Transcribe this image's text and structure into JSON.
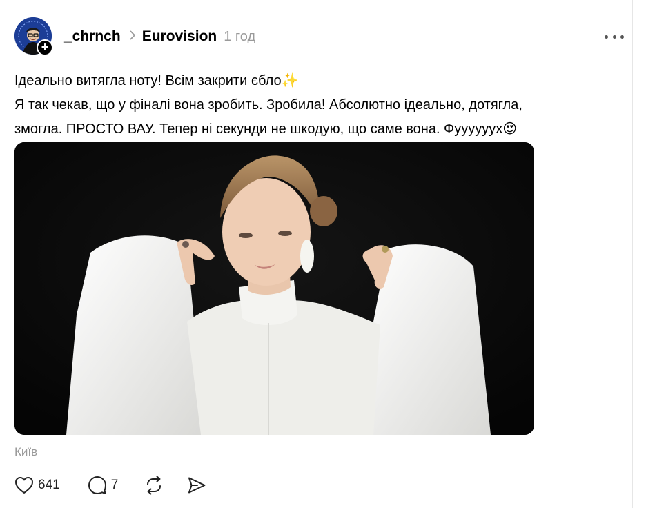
{
  "post": {
    "username": "_chrnch",
    "community": "Eurovision",
    "timestamp": "1 год",
    "lines": [
      "Ідеально витягла ноту! Всім закрити єбло✨",
      "Я так чекав, що у фіналі вона зробить. Зробила! Абсолютно ідеально, дотягла,",
      "змогла. ПРОСТО ВАУ. Тепер ні секунди не шкодую, що саме вона. Фууууууx😍"
    ],
    "location": "Київ",
    "likes": "641",
    "comments": "7",
    "follow_badge": "+"
  },
  "icons": {
    "more": "ellipsis-icon",
    "chevron": "chevron-right-icon",
    "like": "heart-icon",
    "comment": "speech-bubble-icon",
    "repost": "repost-icon",
    "share": "send-icon"
  },
  "colors": {
    "muted": "#9a9a9a",
    "photo_bg": "#0b0b0b",
    "dress": "#f2f2f0"
  }
}
